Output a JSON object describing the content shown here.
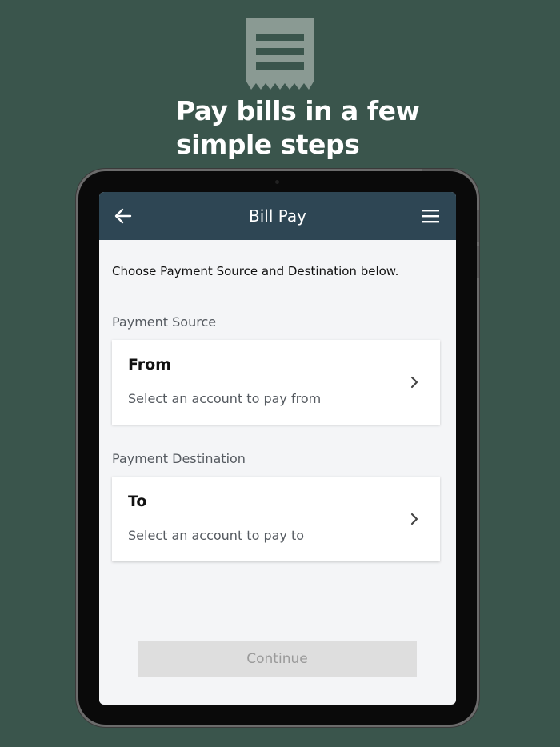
{
  "promo": {
    "headline_line1": "Pay bills in a few",
    "headline_line2": "simple steps",
    "icon": "receipt-icon"
  },
  "app": {
    "title": "Bill Pay",
    "back_icon": "arrow-left-icon",
    "menu_icon": "hamburger-menu-icon"
  },
  "form": {
    "instruction": "Choose Payment Source and Destination below.",
    "source": {
      "section_label": "Payment Source",
      "title": "From",
      "placeholder": "Select an account to pay from"
    },
    "destination": {
      "section_label": "Payment Destination",
      "title": "To",
      "placeholder": "Select an account to pay to"
    },
    "continue_label": "Continue",
    "continue_enabled": false
  },
  "colors": {
    "background": "#3a554c",
    "navbar": "#2e4654",
    "screen": "#f4f5f7",
    "button_disabled": "#dedede",
    "button_text_disabled": "#9a9a9a"
  }
}
